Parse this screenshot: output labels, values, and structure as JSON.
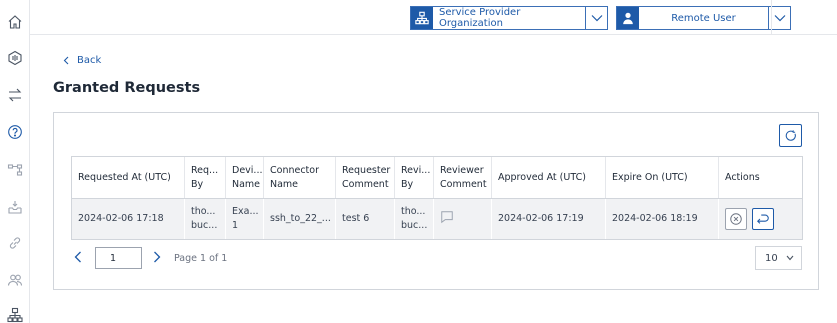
{
  "rail": {
    "items": [
      {
        "icon": "home-icon"
      },
      {
        "icon": "device-icon"
      },
      {
        "icon": "transfer-icon"
      },
      {
        "icon": "help-icon"
      },
      {
        "icon": "workflow-icon"
      },
      {
        "icon": "inbox-icon"
      },
      {
        "icon": "link-icon"
      },
      {
        "icon": "users-icon"
      },
      {
        "icon": "hierarchy-icon"
      }
    ]
  },
  "topbar": {
    "organization": {
      "label": "Service Provider Organization",
      "icon": "hierarchy-icon"
    },
    "user": {
      "label": "Remote User",
      "icon": "user-icon"
    }
  },
  "back_label": "Back",
  "page_title": "Granted Requests",
  "table": {
    "headers": [
      "Requested At (UTC)",
      "Req... By",
      "Devi... Name",
      "Connector Name",
      "Requester Comment",
      "Revi... By",
      "Reviewer Comment",
      "Approved At (UTC)",
      "Expire On (UTC)",
      "Actions"
    ],
    "rows": [
      {
        "requested_at": "2024-02-06 17:18",
        "requested_by": "tho... buc...",
        "device_name": "Exa... 1",
        "connector_name": "ssh_to_22_...",
        "requester_comment": "test 6",
        "reviewed_by": "tho... buc...",
        "approved_at": "2024-02-06 17:19",
        "expire_on": "2024-02-06 18:19"
      }
    ]
  },
  "pagination": {
    "current_page": "1",
    "page_info": "Page 1 of 1",
    "page_size": "10"
  },
  "colors": {
    "accent": "#1e5aa8",
    "row_bg": "#f1f2f4",
    "border": "#d1d5db"
  }
}
